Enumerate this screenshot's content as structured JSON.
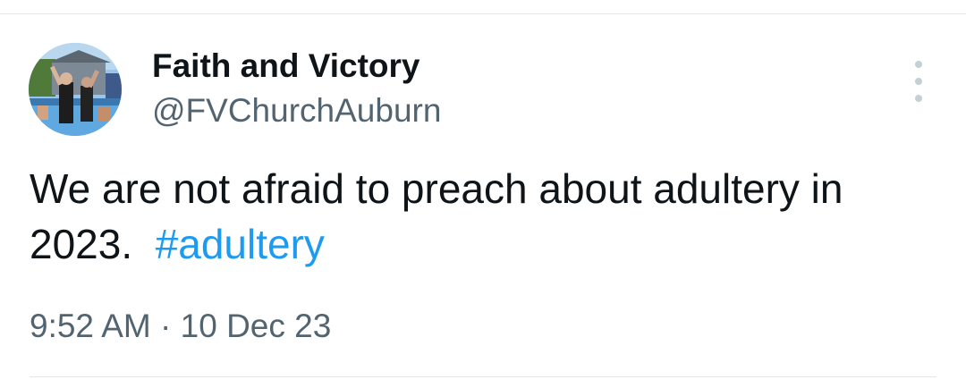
{
  "tweet": {
    "author": {
      "display_name": "Faith and Victory",
      "handle": "@FVChurchAuburn",
      "avatar_icon": "church-baptism-photo"
    },
    "text_plain": "We are not afraid to preach about adultery in 2023.",
    "hashtag": "#adultery",
    "time": "9:52 AM",
    "separator": "·",
    "date": "10 Dec 23",
    "more_icon": "more-options-icon"
  },
  "colors": {
    "text_primary": "#0f1419",
    "text_secondary": "#536471",
    "link": "#1d9bf0",
    "divider": "#e1e6ea"
  }
}
